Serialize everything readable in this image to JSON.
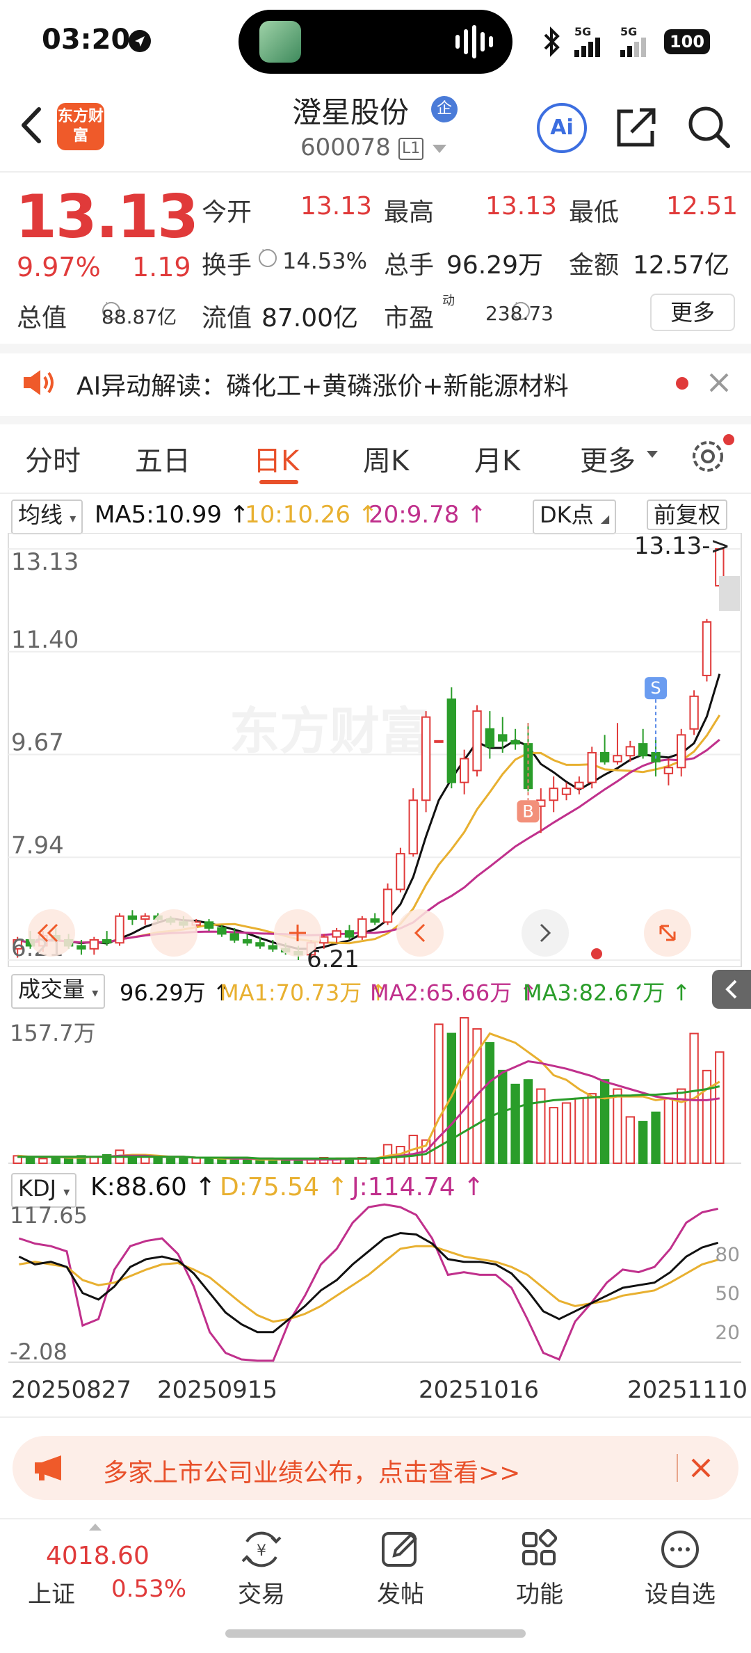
{
  "status_bar": {
    "time": "03:20",
    "network": "5G",
    "battery": "100"
  },
  "header": {
    "brand_logo": "东方财富",
    "stock_name": "澄星股份",
    "enterprise_badge": "企",
    "stock_code": "600078",
    "level_badge": "L1",
    "ai_label": "Ai",
    "icons": [
      "back-icon",
      "share-icon",
      "search-icon"
    ]
  },
  "quote": {
    "price": "13.13",
    "change_pct": "9.97%",
    "change_amt": "1.19",
    "open_label": "今开",
    "open": "13.13",
    "high_label": "最高",
    "high": "13.13",
    "low_label": "最低",
    "low": "12.51",
    "turnover_label": "换手",
    "turnover": "14.53%",
    "volume_label": "总手",
    "volume": "96.29万",
    "amount_label": "金额",
    "amount": "12.57亿",
    "mktcap_label": "总值",
    "mktcap": "88.87亿",
    "float_label": "流值",
    "float_cap": "87.00亿",
    "pe_label": "市盈",
    "pe_sup": "动",
    "pe": "238.73",
    "more_label": "更多"
  },
  "ai_banner": {
    "text": "AI异动解读：磷化工+黄磷涨价+新能源材料"
  },
  "tabs": {
    "items": [
      "分时",
      "五日",
      "日K",
      "周K",
      "月K",
      "更多"
    ],
    "active": "日K"
  },
  "ma_legend": {
    "select_label": "均线",
    "ma5": "MA5:10.99",
    "ma10": "10:10.26",
    "ma20": "20:9.78",
    "dk_label": "DK点",
    "adjust_label": "前复权"
  },
  "main_chart_labels": {
    "y_ticks": [
      "13.13",
      "11.40",
      "9.67",
      "7.94",
      "6.21"
    ],
    "last_price_marker": "13.13->",
    "low_marker": "6.21",
    "buy_marker": "B",
    "sell_marker": "S",
    "watermark": "东方财富"
  },
  "volume_legend": {
    "select_label": "成交量",
    "vol": "96.29万",
    "ma1": "MA1:70.73万",
    "ma2": "MA2:65.66万",
    "ma3": "MA3:82.67万",
    "y_top": "157.7万"
  },
  "kdj_legend": {
    "select_label": "KDJ",
    "k": "K:88.60",
    "d": "D:75.54",
    "j": "J:114.74",
    "y_top": "117.65",
    "y_bottom": "-2.08",
    "ref_levels": [
      "80",
      "50",
      "20"
    ]
  },
  "x_axis_dates": [
    "20250827",
    "20250915",
    "20251016",
    "20251110"
  ],
  "colors": {
    "up": "#e03a3a",
    "down": "#2a9d2a",
    "ma5": "#111111",
    "ma10": "#e8b030",
    "ma20": "#c0308c",
    "accent": "#e8502a"
  },
  "chart_data": {
    "type": "candlestick",
    "title": "",
    "ylim": [
      6.21,
      13.13
    ],
    "candles": [
      {
        "o": 6.4,
        "h": 6.6,
        "l": 6.25,
        "c": 6.55
      },
      {
        "o": 6.55,
        "h": 6.7,
        "l": 6.4,
        "c": 6.45
      },
      {
        "o": 6.45,
        "h": 6.7,
        "l": 6.35,
        "c": 6.62
      },
      {
        "o": 6.62,
        "h": 6.75,
        "l": 6.5,
        "c": 6.55
      },
      {
        "o": 6.55,
        "h": 6.65,
        "l": 6.4,
        "c": 6.45
      },
      {
        "o": 6.45,
        "h": 6.55,
        "l": 6.3,
        "c": 6.4
      },
      {
        "o": 6.4,
        "h": 6.6,
        "l": 6.3,
        "c": 6.55
      },
      {
        "o": 6.55,
        "h": 6.7,
        "l": 6.45,
        "c": 6.5
      },
      {
        "o": 6.5,
        "h": 7.0,
        "l": 6.45,
        "c": 6.95
      },
      {
        "o": 6.95,
        "h": 7.05,
        "l": 6.8,
        "c": 6.9
      },
      {
        "o": 6.9,
        "h": 7.0,
        "l": 6.8,
        "c": 6.95
      },
      {
        "o": 6.95,
        "h": 7.0,
        "l": 6.85,
        "c": 6.9
      },
      {
        "o": 6.9,
        "h": 6.95,
        "l": 6.8,
        "c": 6.85
      },
      {
        "o": 6.85,
        "h": 6.95,
        "l": 6.75,
        "c": 6.8
      },
      {
        "o": 6.8,
        "h": 6.9,
        "l": 6.7,
        "c": 6.85
      },
      {
        "o": 6.85,
        "h": 6.9,
        "l": 6.7,
        "c": 6.75
      },
      {
        "o": 6.75,
        "h": 6.8,
        "l": 6.6,
        "c": 6.65
      },
      {
        "o": 6.65,
        "h": 6.75,
        "l": 6.5,
        "c": 6.55
      },
      {
        "o": 6.55,
        "h": 6.65,
        "l": 6.45,
        "c": 6.5
      },
      {
        "o": 6.5,
        "h": 6.6,
        "l": 6.4,
        "c": 6.45
      },
      {
        "o": 6.45,
        "h": 6.55,
        "l": 6.35,
        "c": 6.4
      },
      {
        "o": 6.4,
        "h": 6.5,
        "l": 6.3,
        "c": 6.35
      },
      {
        "o": 6.35,
        "h": 6.45,
        "l": 6.21,
        "c": 6.3
      },
      {
        "o": 6.3,
        "h": 6.55,
        "l": 6.25,
        "c": 6.5
      },
      {
        "o": 6.5,
        "h": 6.65,
        "l": 6.4,
        "c": 6.6
      },
      {
        "o": 6.6,
        "h": 6.75,
        "l": 6.5,
        "c": 6.7
      },
      {
        "o": 6.7,
        "h": 6.8,
        "l": 6.55,
        "c": 6.6
      },
      {
        "o": 6.6,
        "h": 6.95,
        "l": 6.55,
        "c": 6.9
      },
      {
        "o": 6.9,
        "h": 7.0,
        "l": 6.8,
        "c": 6.85
      },
      {
        "o": 6.85,
        "h": 7.5,
        "l": 6.8,
        "c": 7.4
      },
      {
        "o": 7.4,
        "h": 8.1,
        "l": 7.35,
        "c": 8.0
      },
      {
        "o": 8.0,
        "h": 9.1,
        "l": 7.95,
        "c": 8.9
      },
      {
        "o": 8.9,
        "h": 10.4,
        "l": 8.7,
        "c": 10.3
      },
      {
        "o": 9.9,
        "h": 9.9,
        "l": 9.9,
        "c": 9.9
      },
      {
        "o": 10.6,
        "h": 10.8,
        "l": 9.1,
        "c": 9.2
      },
      {
        "o": 9.2,
        "h": 9.75,
        "l": 9.0,
        "c": 9.6
      },
      {
        "o": 9.4,
        "h": 10.5,
        "l": 9.3,
        "c": 10.4
      },
      {
        "o": 10.1,
        "h": 10.4,
        "l": 9.6,
        "c": 9.8
      },
      {
        "o": 10.0,
        "h": 10.3,
        "l": 9.7,
        "c": 9.9
      },
      {
        "o": 9.9,
        "h": 10.1,
        "l": 9.75,
        "c": 9.85
      },
      {
        "o": 9.85,
        "h": 10.2,
        "l": 9.05,
        "c": 9.1
      },
      {
        "o": 8.8,
        "h": 9.1,
        "l": 8.35,
        "c": 8.9
      },
      {
        "o": 8.9,
        "h": 9.3,
        "l": 8.7,
        "c": 9.1
      },
      {
        "o": 9.0,
        "h": 9.2,
        "l": 8.9,
        "c": 9.1
      },
      {
        "o": 9.1,
        "h": 9.3,
        "l": 9.0,
        "c": 9.2
      },
      {
        "o": 9.2,
        "h": 9.8,
        "l": 9.1,
        "c": 9.7
      },
      {
        "o": 9.7,
        "h": 10.0,
        "l": 9.5,
        "c": 9.55
      },
      {
        "o": 9.55,
        "h": 10.2,
        "l": 9.5,
        "c": 9.65
      },
      {
        "o": 9.65,
        "h": 9.9,
        "l": 9.55,
        "c": 9.8
      },
      {
        "o": 9.85,
        "h": 10.1,
        "l": 9.6,
        "c": 9.65
      },
      {
        "o": 9.7,
        "h": 9.95,
        "l": 9.3,
        "c": 9.55
      },
      {
        "o": 9.35,
        "h": 9.6,
        "l": 9.15,
        "c": 9.45
      },
      {
        "o": 9.45,
        "h": 10.1,
        "l": 9.3,
        "c": 10.0
      },
      {
        "o": 10.1,
        "h": 10.75,
        "l": 10.0,
        "c": 10.65
      },
      {
        "o": 11.0,
        "h": 11.95,
        "l": 10.9,
        "c": 11.9
      },
      {
        "o": 12.51,
        "h": 13.13,
        "l": 12.51,
        "c": 13.13
      }
    ],
    "ma5_last": 10.99,
    "ma10_last": 10.26,
    "ma20_last": 9.78,
    "volume": {
      "ymax": 157.7,
      "bars": [
        8,
        6,
        5,
        7,
        6,
        8,
        7,
        9,
        14,
        8,
        7,
        6,
        5,
        5,
        6,
        5,
        5,
        4,
        4,
        4,
        4,
        4,
        3,
        5,
        6,
        5,
        4,
        6,
        5,
        20,
        18,
        30,
        25,
        150,
        140,
        157,
        145,
        130,
        100,
        85,
        90,
        80,
        60,
        65,
        70,
        75,
        90,
        80,
        50,
        45,
        55,
        70,
        80,
        140,
        100,
        120
      ],
      "ma1": [
        8,
        7,
        7,
        7,
        6,
        6,
        7,
        7,
        8,
        9,
        9,
        8,
        7,
        7,
        6,
        6,
        5,
        5,
        5,
        4,
        4,
        4,
        4,
        4,
        4,
        5,
        5,
        5,
        5,
        8,
        10,
        15,
        19,
        48,
        72,
        100,
        120,
        140,
        135,
        130,
        120,
        110,
        95,
        90,
        80,
        72,
        70,
        72,
        72,
        72,
        68,
        70,
        66,
        70,
        80,
        88
      ],
      "ma2": [
        7,
        7,
        7,
        7,
        7,
        7,
        7,
        7,
        8,
        8,
        8,
        7,
        7,
        7,
        6,
        6,
        6,
        5,
        5,
        5,
        5,
        4,
        4,
        4,
        4,
        4,
        5,
        5,
        5,
        6,
        8,
        10,
        13,
        28,
        42,
        58,
        74,
        88,
        98,
        104,
        110,
        108,
        105,
        102,
        98,
        94,
        88,
        84,
        80,
        76,
        72,
        70,
        69,
        68,
        68,
        70
      ],
      "ma3": [
        7,
        7,
        7,
        7,
        7,
        7,
        7,
        7,
        7,
        7,
        7,
        7,
        7,
        7,
        6,
        6,
        6,
        6,
        6,
        5,
        5,
        5,
        5,
        5,
        5,
        5,
        5,
        5,
        5,
        6,
        7,
        8,
        10,
        18,
        26,
        34,
        42,
        50,
        56,
        60,
        64,
        66,
        68,
        69,
        70,
        71,
        72,
        73,
        73,
        74,
        74,
        75,
        76,
        78,
        80,
        83
      ]
    },
    "kdj": {
      "ylim": [
        -2.08,
        117.65
      ],
      "k": [
        78,
        72,
        74,
        70,
        50,
        45,
        55,
        70,
        76,
        78,
        75,
        65,
        50,
        35,
        26,
        20,
        20,
        30,
        40,
        52,
        60,
        72,
        82,
        92,
        96,
        95,
        88,
        76,
        74,
        74,
        72,
        65,
        52,
        36,
        30,
        36,
        42,
        48,
        54,
        56,
        58,
        66,
        78,
        85,
        88.6
      ],
      "d": [
        72,
        74,
        72,
        70,
        60,
        56,
        58,
        63,
        68,
        72,
        73,
        68,
        62,
        52,
        42,
        33,
        28,
        30,
        34,
        40,
        48,
        56,
        64,
        74,
        84,
        86,
        86,
        82,
        78,
        76,
        74,
        70,
        64,
        54,
        44,
        40,
        42,
        44,
        48,
        50,
        52,
        58,
        65,
        72,
        75.54
      ],
      "j": [
        92,
        88,
        86,
        82,
        25,
        30,
        68,
        86,
        90,
        92,
        80,
        55,
        20,
        4,
        -1,
        -2,
        -2,
        28,
        48,
        72,
        84,
        104,
        116,
        118,
        116,
        110,
        92,
        64,
        66,
        64,
        64,
        54,
        30,
        4,
        -1,
        28,
        42,
        58,
        68,
        66,
        70,
        84,
        104,
        112,
        114.74
      ]
    }
  },
  "notice": {
    "text": "多家上市公司业绩公布，点击查看>>"
  },
  "bottom_nav": {
    "index_value": "4018.60",
    "index_name": "上证",
    "index_change": "0.53%",
    "items": [
      {
        "label": "交易",
        "icon": "trade-icon"
      },
      {
        "label": "发帖",
        "icon": "post-icon"
      },
      {
        "label": "功能",
        "icon": "function-icon"
      },
      {
        "label": "设自选",
        "icon": "watchlist-icon"
      }
    ]
  }
}
